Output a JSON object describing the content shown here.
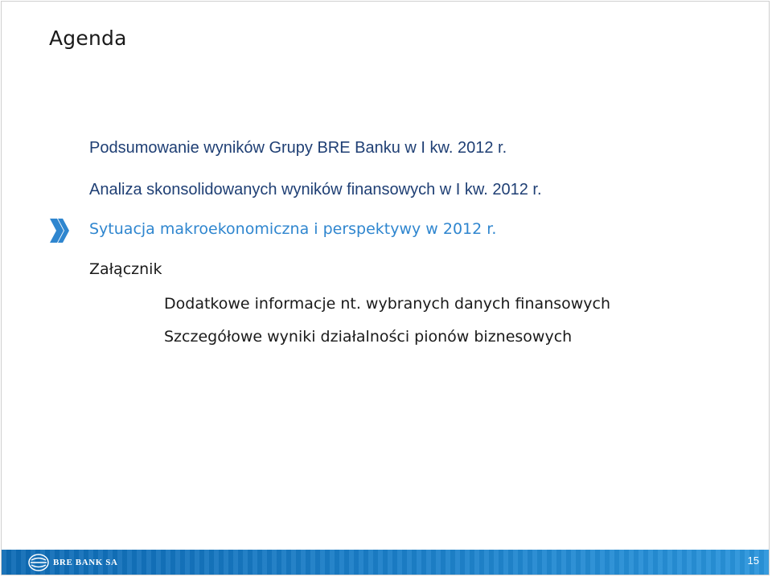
{
  "slide": {
    "title": "Agenda",
    "items": [
      {
        "label": "Podsumowanie wyników Grupy BRE Banku w I kw. 2012 r."
      },
      {
        "label": "Analiza skonsolidowanych wyników finansowych w I kw. 2012 r."
      },
      {
        "label": "Sytuacja makroekonomiczna i perspektywy w 2012 r."
      },
      {
        "label": "Załącznik"
      }
    ],
    "subitems": [
      {
        "label": "Dodatkowe informacje nt. wybranych danych finansowych"
      },
      {
        "label": "Szczegółowe wyniki działalności pionów biznesowych"
      }
    ],
    "marker_icon": "double-chevron-right-icon"
  },
  "footer": {
    "brand": "BRE BANK SA",
    "logo_icon": "bre-logo-icon",
    "page_number": "15"
  },
  "colors": {
    "active_item": "#2f86cf",
    "item": "#1f3f74",
    "footer_bar": "#1b7fc9"
  }
}
